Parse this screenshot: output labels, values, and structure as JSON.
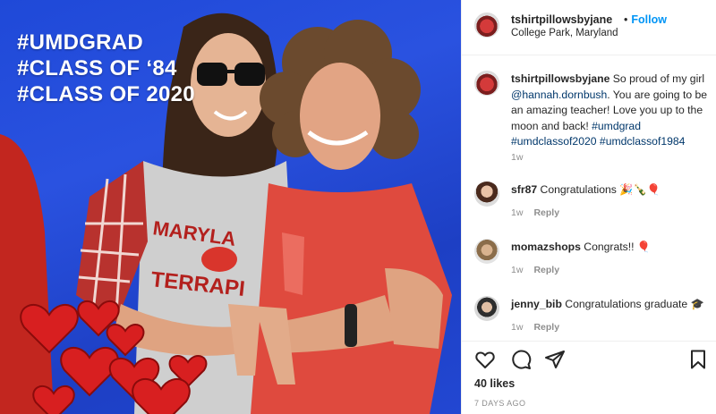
{
  "post": {
    "overlay_lines": [
      "#UMDGRAD",
      "#CLASS OF ‘84",
      "#CLASS OF 2020"
    ],
    "owner": {
      "username": "tshirtpillowsbyjane",
      "follow_separator": "•",
      "follow_label": "Follow",
      "location": "College Park, Maryland"
    },
    "caption": {
      "username": "tshirtpillowsbyjane",
      "text_before": " So proud of my girl ",
      "mention": "@hannah.dornbush",
      "text_after": ". You are going to be an amazing teacher! Love you up to the moon and back! ",
      "tags": "#umdgrad #umdclassof2020 #umdclassof1984",
      "time": "1w"
    },
    "comments": [
      {
        "username": "sfr87",
        "text": " Congratulations 🎉🍾🎈",
        "time": "1w",
        "reply_label": "Reply"
      },
      {
        "username": "momazshops",
        "text": " Congrats!! 🎈",
        "time": "1w",
        "reply_label": "Reply"
      },
      {
        "username": "jenny_bib",
        "text": " Congratulations graduate 🎓",
        "time": "1w",
        "reply_label": "Reply"
      }
    ],
    "likes": "40 likes",
    "posted": "7 DAYS AGO"
  },
  "icons": {
    "like": "heart-icon",
    "comment": "comment-icon",
    "share": "paper-plane-icon",
    "save": "bookmark-icon"
  },
  "colors": {
    "accent": "#0095f6",
    "link": "#00376b",
    "muted": "#8e8e8e",
    "background_blue": "#2a52e0"
  }
}
